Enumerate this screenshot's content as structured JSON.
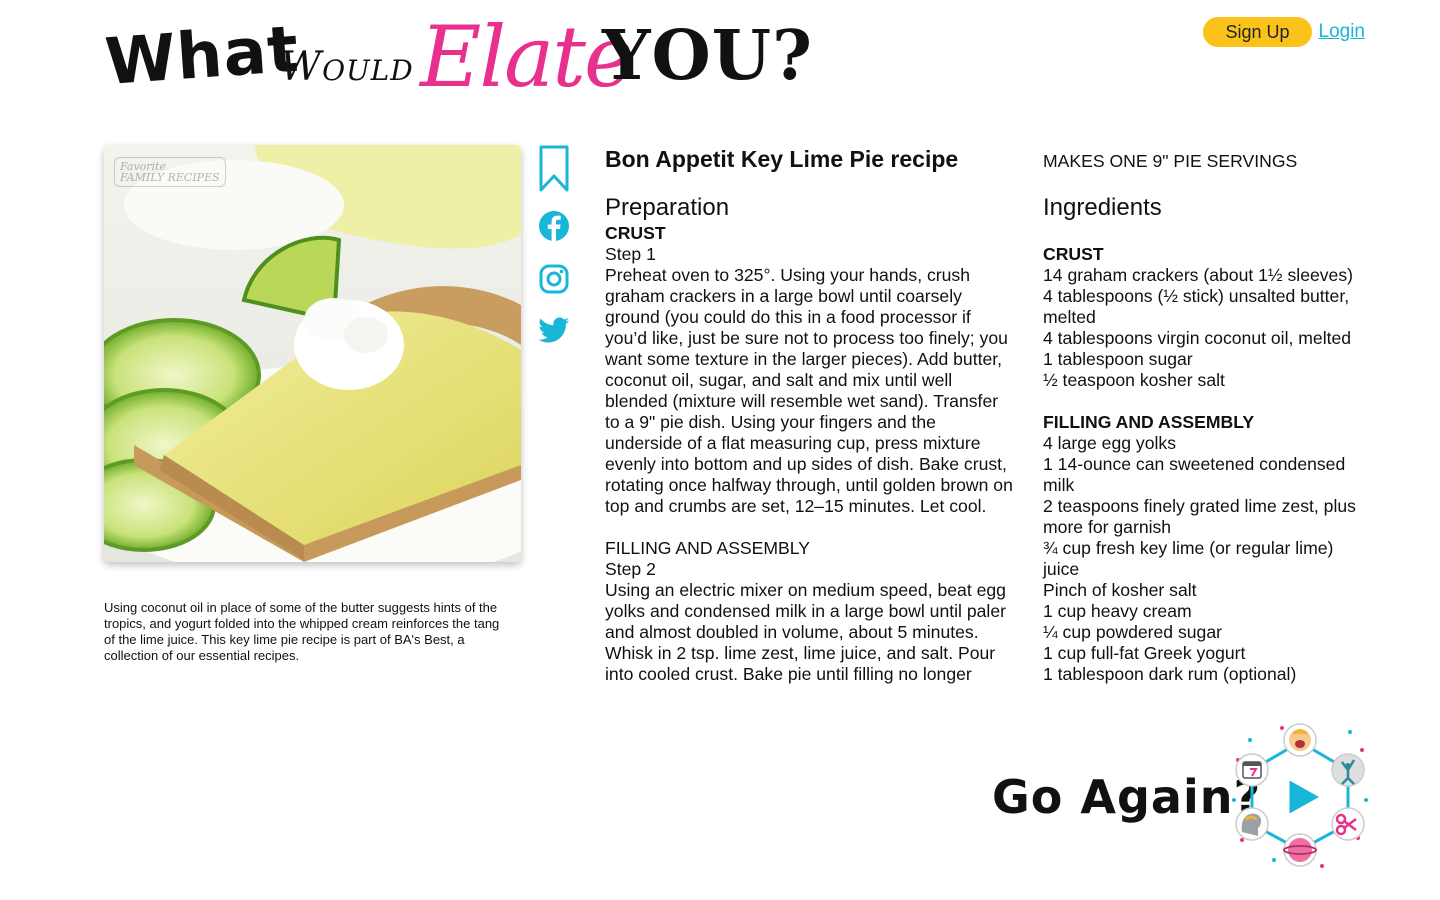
{
  "header": {
    "logo": {
      "what": "What",
      "would": "Would",
      "elate": "Elate",
      "you": "YOU?"
    },
    "signup_label": "Sign Up",
    "login_label": "Login",
    "colors": {
      "signup_bg": "#fbc31a",
      "login": "#1ab6d8",
      "elate": "#e8318f"
    }
  },
  "image": {
    "watermark_line1": "Favorite",
    "watermark_line2": "FAMILY RECIPES",
    "caption": "Using coconut oil in place of some of the butter suggests hints of the tropics, and yogurt folded into the whipped cream reinforces the tang of the lime juice. This key lime pie recipe is part of BA's Best, a collection of our essential recipes."
  },
  "social": {
    "icons": [
      "bookmark-icon",
      "facebook-icon",
      "instagram-icon",
      "twitter-icon"
    ],
    "color": "#1ab6d8"
  },
  "recipe": {
    "title": "Bon Appetit Key Lime Pie recipe",
    "preparation_heading": "Preparation",
    "crust_label": "CRUST",
    "step1_label": "Step 1",
    "step1_text": "Preheat oven to 325°. Using your hands, crush graham crackers in a large bowl until coarsely ground (you could do this in a food processor if you’d like, just be sure not to process too finely; you want some texture in the larger pieces). Add butter, coconut oil, sugar, and salt and mix until well blended (mixture will resemble wet sand). Transfer to a 9\" pie dish. Using your fingers and the underside of a flat measuring cup, press mixture evenly into bottom and up sides of dish. Bake crust, rotating once halfway through, until golden brown on top and crumbs are set, 12–15 minutes. Let cool.",
    "filling_label": "FILLING AND ASSEMBLY",
    "step2_label": "Step 2",
    "step2_text": "Using an electric mixer on medium speed, beat egg yolks and condensed milk in a large bowl until paler and almost doubled in volume, about 5 minutes. Whisk in 2 tsp. lime zest, lime juice, and salt. Pour into cooled crust. Bake pie until filling no longer"
  },
  "ingredients": {
    "servings": "MAKES ONE 9\" PIE SERVINGS",
    "heading": "Ingredients",
    "crust_label": "CRUST",
    "crust_items": [
      "14 graham crackers (about 1½ sleeves)",
      "4 tablespoons (½ stick) unsalted butter, melted",
      "4 tablespoons virgin coconut oil, melted",
      "1 tablespoon sugar",
      "½ teaspoon kosher salt"
    ],
    "filling_label": "FILLING AND ASSEMBLY",
    "filling_items": [
      "4 large egg yolks",
      "1 14-ounce can sweetened condensed milk",
      "2 teaspoons finely grated lime zest, plus more for garnish",
      "¾ cup fresh key lime (or regular lime) juice",
      "Pinch of kosher salt",
      "1 cup heavy cream",
      "¼ cup powdered sugar",
      "1 cup full-fat Greek yogurt",
      "1 tablespoon dark rum (optional)"
    ]
  },
  "footer": {
    "go_again_label": "Go Again?",
    "play_color": "#1ab6d8"
  }
}
